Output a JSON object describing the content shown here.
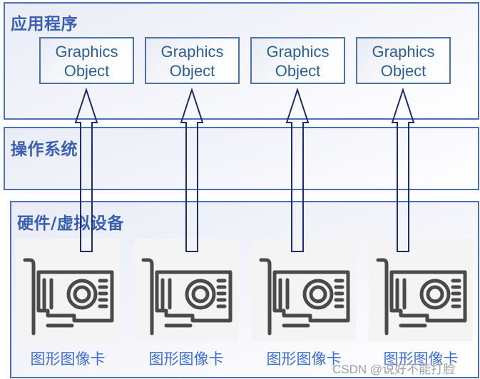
{
  "layers": {
    "application": {
      "title": "应用程序"
    },
    "os": {
      "title": "操作系统"
    },
    "hardware": {
      "title": "硬件/虚拟设备"
    }
  },
  "graphics_objects": [
    {
      "line1": "Graphics",
      "line2": "Object"
    },
    {
      "line1": "Graphics",
      "line2": "Object"
    },
    {
      "line1": "Graphics",
      "line2": "Object"
    },
    {
      "line1": "Graphics",
      "line2": "Object"
    }
  ],
  "cards": [
    {
      "label": "图形图像卡",
      "icon": "graphics-card-icon"
    },
    {
      "label": "图形图像卡",
      "icon": "graphics-card-icon"
    },
    {
      "label": "图形图像卡",
      "icon": "graphics-card-icon"
    },
    {
      "label": "图形图像卡",
      "icon": "graphics-card-icon"
    }
  ],
  "arrows": [
    {
      "from": "graphics-card-1",
      "to": "graphics-object-1",
      "direction": "up"
    },
    {
      "from": "graphics-card-2",
      "to": "graphics-object-2",
      "direction": "up"
    },
    {
      "from": "graphics-card-3",
      "to": "graphics-object-3",
      "direction": "up"
    },
    {
      "from": "graphics-card-4",
      "to": "graphics-object-4",
      "direction": "up"
    }
  ],
  "colors": {
    "layer_border": "#4a6fb5",
    "title_text": "#3a5fae",
    "object_text": "#2e5f8e",
    "arrow_stroke": "#1b2f66",
    "card_label": "#3f6fc8",
    "icon_stroke": "#4a4a4a"
  },
  "watermark": "CSDN @说好不能打脸"
}
